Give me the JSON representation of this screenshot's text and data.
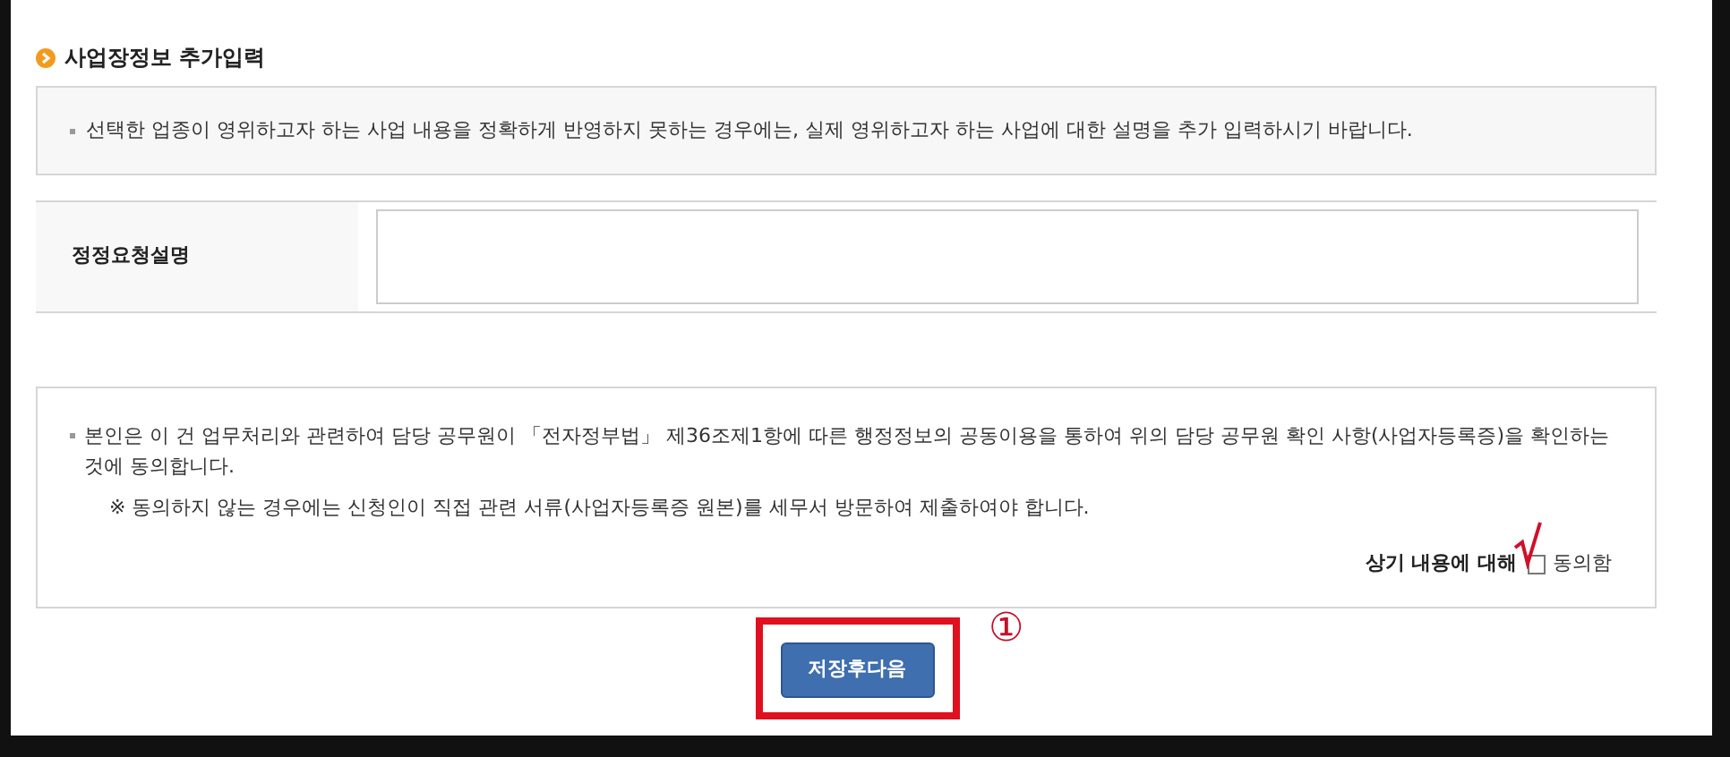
{
  "section": {
    "title": "사업장정보 추가입력",
    "notice": "선택한 업종이 영위하고자 하는 사업 내용을 정확하게 반영하지 못하는 경우에는, 실제 영위하고자 하는 사업에 대한 설명을 추가 입력하시기 바랍니다."
  },
  "form": {
    "label": "정정요청설명"
  },
  "consent": {
    "statement": "본인은 이 건 업무처리와 관련하여 담당 공무원이 「전자정부법」 제36조제1항에 따른 행정정보의 공동이용을 통하여 위의 담당 공무원 확인 사항(사업자등록증)을 확인하는 것에 동의합니다.",
    "note": "※  동의하지 않는 경우에는 신청인이 직접 관련 서류(사업자등록증 원본)를 세무서 방문하여 제출하여야 합니다.",
    "agree_prefix": "상기 내용에 대해",
    "checkbox": {
      "label": "동의함",
      "checked": false
    }
  },
  "button": {
    "label": "저장후다음"
  },
  "annotation": {
    "marker": "①"
  }
}
